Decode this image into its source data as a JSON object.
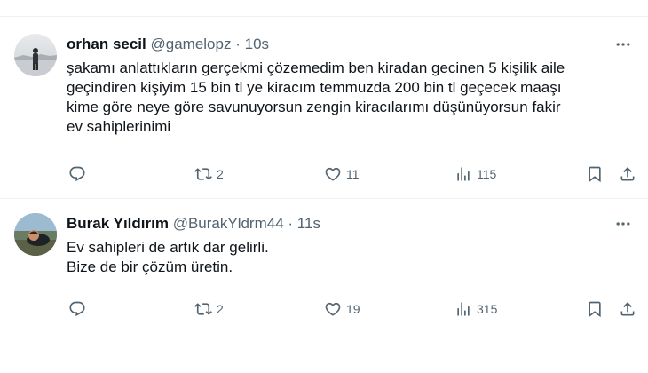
{
  "tweets": [
    {
      "name": "orhan secil",
      "handle": "@gamelopz",
      "separator": "·",
      "time": "10s",
      "text_lines": [
        "şakamı anlattıkların gerçekmi çözemedim ben kiradan gecinen 5 kişilik aile",
        "geçindiren kişiyim 15 bin tl ye kiracım temmuzda 200 bin tl geçecek maaşı",
        "kime göre neye göre savunuyorsun zengin kiracılarımı düşünüyorsun fakir",
        "ev sahiplerinimi"
      ],
      "retweets": "2",
      "likes": "11",
      "views": "115"
    },
    {
      "name": "Burak Yıldırım",
      "handle": "@BurakYldrm44",
      "separator": "·",
      "time": "11s",
      "text_lines": [
        "Ev sahipleri de artık dar gelirli.",
        "Bize de bir çözüm üretin."
      ],
      "retweets": "2",
      "likes": "19",
      "views": "315"
    }
  ],
  "icons": {
    "more": "more-horizontal-icon",
    "reply": "reply-icon",
    "retweet": "retweet-icon",
    "like": "heart-icon",
    "views": "views-icon",
    "bookmark": "bookmark-icon",
    "share": "share-icon"
  },
  "colors": {
    "text_primary": "#0f1419",
    "text_secondary": "#536471",
    "divider": "#eff3f4"
  }
}
